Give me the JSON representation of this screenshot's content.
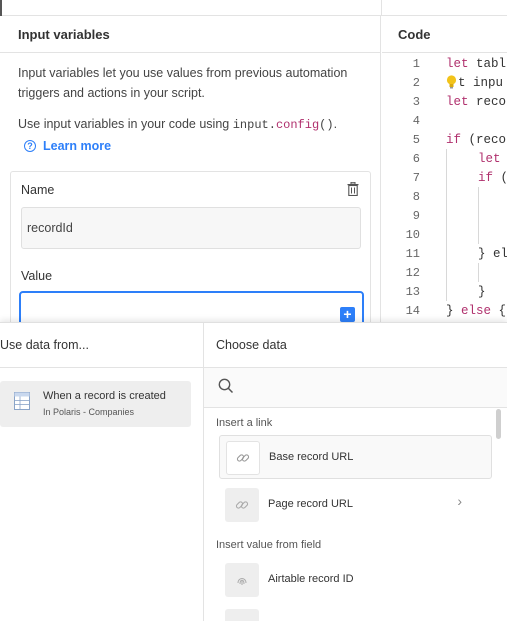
{
  "input_panel": {
    "title": "Input variables",
    "description": "Input variables let you use values from previous automation triggers and actions in your script.",
    "usage_prefix": "Use input variables in your code using ",
    "usage_code_obj": "input",
    "usage_code_dot": ".",
    "usage_code_method": "config",
    "usage_code_parens": "()",
    "usage_suffix": ".",
    "learn_more": "Learn more",
    "variable": {
      "name_label": "Name",
      "name_value": "recordId",
      "value_label": "Value",
      "value_value": ""
    }
  },
  "code_panel": {
    "title": "Code",
    "lines": [
      {
        "n": "1",
        "text": "let tabl"
      },
      {
        "n": "2",
        "text": "t inpu"
      },
      {
        "n": "3",
        "text": "let reco"
      },
      {
        "n": "4",
        "text": ""
      },
      {
        "n": "5",
        "text": "if (reco"
      },
      {
        "n": "6",
        "text": "let "
      },
      {
        "n": "7",
        "text": "if ("
      },
      {
        "n": "8",
        "text": ""
      },
      {
        "n": "9",
        "text": ""
      },
      {
        "n": "10",
        "text": ""
      },
      {
        "n": "11",
        "text": "} el"
      },
      {
        "n": "12",
        "text": ""
      },
      {
        "n": "13",
        "text": "}"
      },
      {
        "n": "14",
        "text": "} else {"
      }
    ]
  },
  "popup": {
    "source_header": "Use data from...",
    "source_item": {
      "title": "When a record is created",
      "subtitle": "In Polaris - Companies"
    },
    "choose_header": "Choose data",
    "search_placeholder": "",
    "groups": {
      "link": "Insert a link",
      "field": "Insert value from field"
    },
    "options": [
      {
        "label": "Base record URL",
        "icon": "link-icon"
      },
      {
        "label": "Page record URL",
        "icon": "link-icon"
      },
      {
        "label": "Airtable record ID",
        "icon": "fingerprint-icon"
      }
    ]
  },
  "colors": {
    "accent": "#2d7ff9",
    "keyword": "#b0306d"
  }
}
